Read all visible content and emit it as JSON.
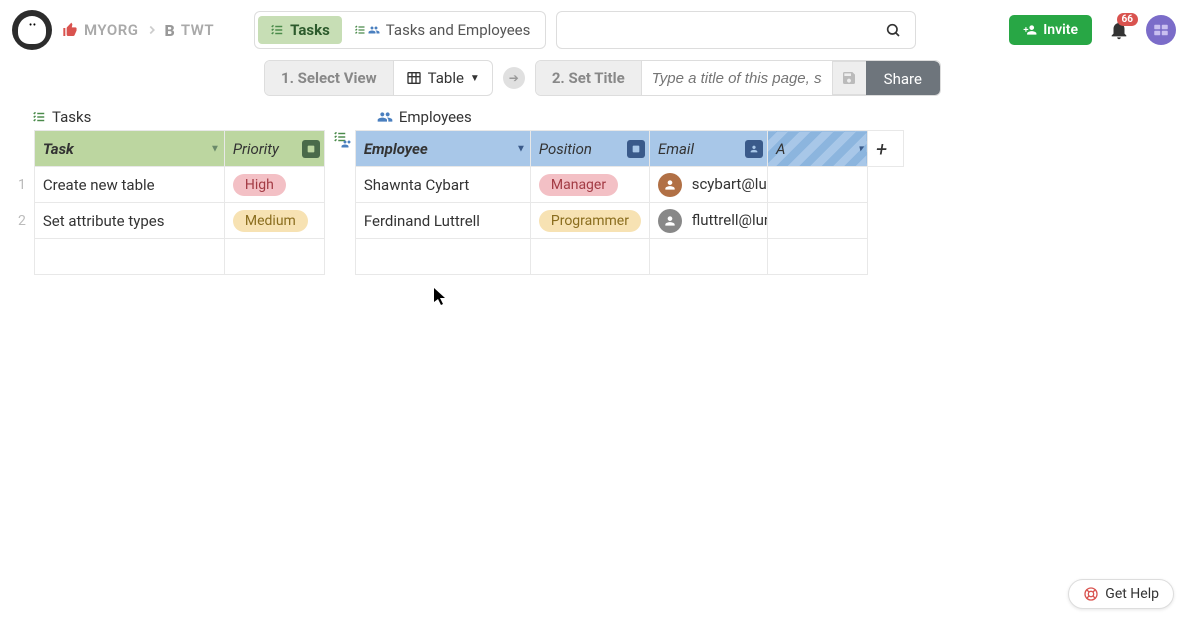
{
  "breadcrumb": {
    "org": "MYORG",
    "project_prefix": "B",
    "project": "TWT"
  },
  "pills": {
    "tasks": "Tasks",
    "tasks_and_employees": "Tasks and Employees"
  },
  "steps": {
    "select_view": "1. Select View",
    "table_label": "Table",
    "set_title": "2. Set Title",
    "title_placeholder": "Type a title of this page, save,",
    "share": "Share"
  },
  "buttons": {
    "invite": "Invite",
    "get_help": "Get Help"
  },
  "notifications": {
    "count": "66"
  },
  "tasks_table": {
    "title": "Tasks",
    "columns": {
      "task": "Task",
      "priority": "Priority"
    },
    "rows": [
      {
        "n": "1",
        "task": "Create new table",
        "priority": "High",
        "priority_class": "high"
      },
      {
        "n": "2",
        "task": "Set attribute types",
        "priority": "Medium",
        "priority_class": "medium"
      }
    ]
  },
  "employees_table": {
    "title": "Employees",
    "columns": {
      "employee": "Employee",
      "position": "Position",
      "email": "Email",
      "new": "A"
    },
    "rows": [
      {
        "employee": "Shawnta Cybart",
        "position": "Manager",
        "position_class": "manager",
        "email": "scybart@lum",
        "avatar_class": "av1"
      },
      {
        "employee": "Ferdinand Luttrell",
        "position": "Programmer",
        "position_class": "programmer",
        "email": "fluttrell@lum",
        "avatar_class": "av2"
      }
    ]
  }
}
